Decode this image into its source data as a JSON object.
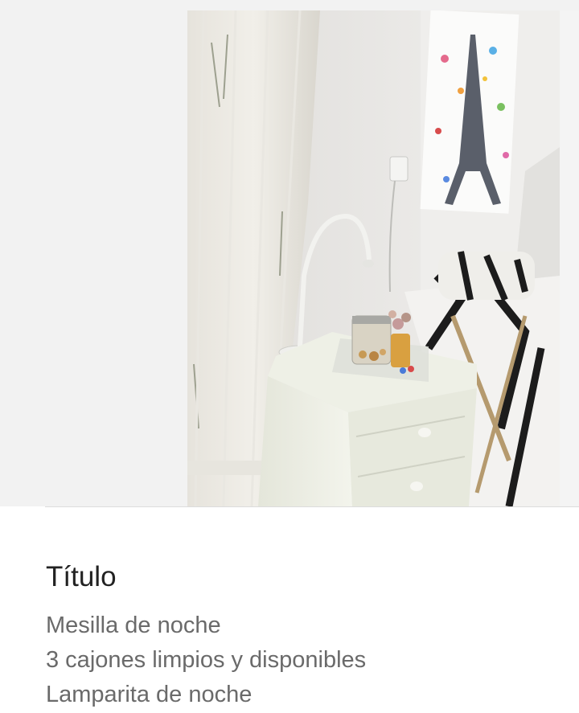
{
  "listing": {
    "section_title": "Título",
    "description_lines": [
      "Mesilla de noche",
      "3 cajones limpios y disponibles",
      "Lamparita de noche"
    ]
  },
  "photo": {
    "subject": "bedside table with lamp beside bed"
  },
  "colors": {
    "title_text": "#222222",
    "body_text": "#6a6a6a",
    "background": "#ffffff",
    "gallery_background": "#f2f2f2"
  }
}
